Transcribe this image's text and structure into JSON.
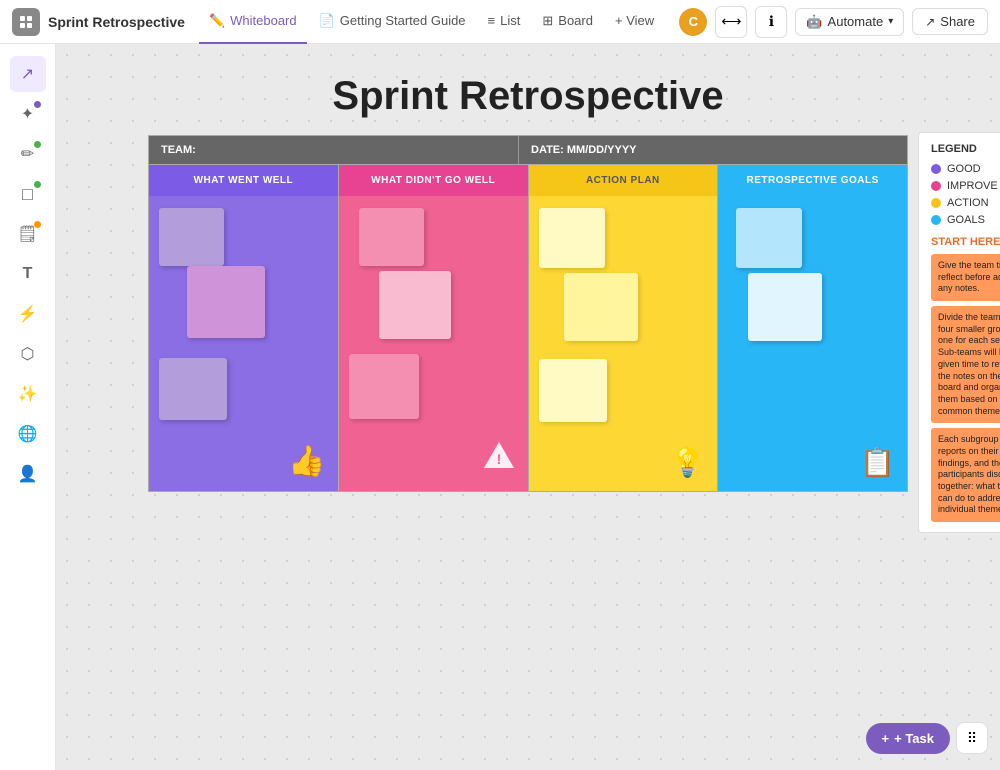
{
  "app": {
    "icon": "⬛",
    "title": "Sprint Retrospective"
  },
  "nav": {
    "tabs": [
      {
        "id": "whiteboard",
        "label": "Whiteboard",
        "icon": "✏️",
        "active": true
      },
      {
        "id": "getting-started",
        "label": "Getting Started Guide",
        "icon": "📄",
        "active": false
      },
      {
        "id": "list",
        "label": "List",
        "icon": "≡",
        "active": false
      },
      {
        "id": "board",
        "label": "Board",
        "icon": "⊞",
        "active": false
      },
      {
        "id": "view",
        "label": "+ View",
        "icon": "",
        "active": false
      }
    ]
  },
  "topbar": {
    "automate_label": "Automate",
    "share_label": "Share",
    "avatar": "C"
  },
  "sidebar": {
    "tools": [
      {
        "id": "select",
        "icon": "↗",
        "active": true,
        "dot": null
      },
      {
        "id": "magic",
        "icon": "✦",
        "active": false,
        "dot": "purple"
      },
      {
        "id": "pen",
        "icon": "✏",
        "active": false,
        "dot": "green"
      },
      {
        "id": "shape",
        "icon": "□",
        "active": false,
        "dot": "green"
      },
      {
        "id": "sticky",
        "icon": "📝",
        "active": false,
        "dot": "orange"
      },
      {
        "id": "text",
        "icon": "T",
        "active": false,
        "dot": null
      },
      {
        "id": "sparkle",
        "icon": "✦",
        "active": false,
        "dot": null
      },
      {
        "id": "connect",
        "icon": "⬡",
        "active": false,
        "dot": null
      },
      {
        "id": "ai",
        "icon": "✨",
        "active": false,
        "dot": null
      },
      {
        "id": "globe",
        "icon": "🌐",
        "active": false,
        "dot": null
      },
      {
        "id": "person",
        "icon": "👤",
        "active": false,
        "dot": null
      }
    ]
  },
  "whiteboard": {
    "title": "Sprint Retrospective",
    "team_label": "TEAM:",
    "date_label": "DATE: MM/DD/YYYY",
    "columns": [
      {
        "id": "went-well",
        "header": "WHAT WENT WELL",
        "color": "purple"
      },
      {
        "id": "didnt-go-well",
        "header": "WHAT DIDN'T GO WELL",
        "color": "pink"
      },
      {
        "id": "action-plan",
        "header": "ACTION PLAN",
        "color": "yellow"
      },
      {
        "id": "retro-goals",
        "header": "RETROSPECTIVE GOALS",
        "color": "blue"
      }
    ]
  },
  "legend": {
    "title": "LEGEND",
    "items": [
      {
        "label": "GOOD",
        "color": "#7c5ce7"
      },
      {
        "label": "IMPROVE",
        "color": "#e84393"
      },
      {
        "label": "ACTION",
        "color": "#f5c518"
      },
      {
        "label": "GOALS",
        "color": "#29b6f6"
      }
    ],
    "start_here": "START HERE!",
    "cards": [
      "Give the team time to reflect before adding any notes.",
      "Divide the team into four smaller groups, one for each section. Sub-teams will be given time to review the notes on their board and organize them based on common themes.",
      "Each subgroup reports on their findings, and then all participants discuss together: what they can do to address the individual themes."
    ]
  },
  "bottom": {
    "task_label": "+ Task"
  }
}
